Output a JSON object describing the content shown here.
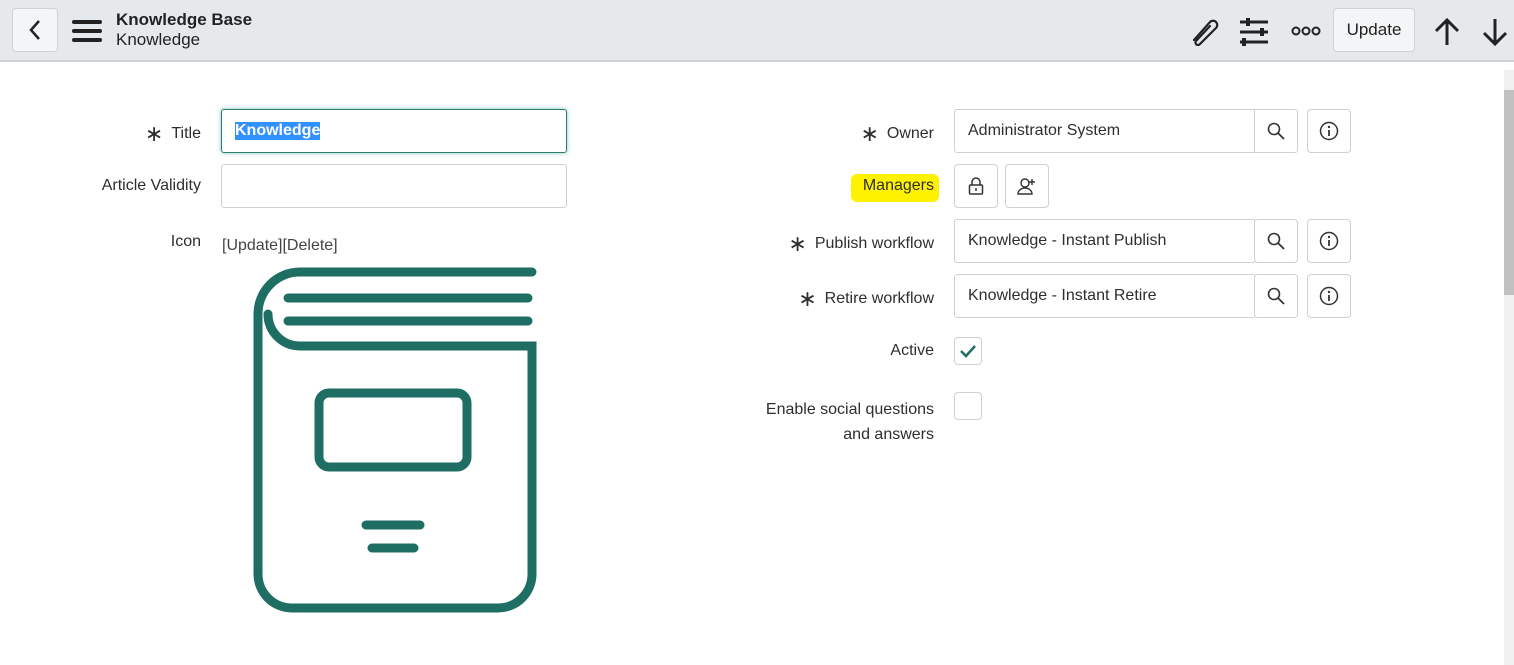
{
  "header": {
    "title": "Knowledge Base",
    "subtitle": "Knowledge",
    "update_label": "Update"
  },
  "form": {
    "title": {
      "label": "Title",
      "value": "Knowledge"
    },
    "article_validity": {
      "label": "Article Validity",
      "value": ""
    },
    "icon": {
      "label": "Icon",
      "update_link": "[Update]",
      "delete_link": "[Delete]"
    },
    "owner": {
      "label": "Owner",
      "value": "Administrator System"
    },
    "managers": {
      "label": "Managers"
    },
    "publish_workflow": {
      "label": "Publish workflow",
      "value": "Knowledge - Instant Publish"
    },
    "retire_workflow": {
      "label": "Retire workflow",
      "value": "Knowledge - Instant Retire"
    },
    "active": {
      "label": "Active",
      "checked": true
    },
    "social_qa": {
      "label_line1": "Enable social questions",
      "label_line2": "and answers",
      "checked": false
    }
  },
  "colors": {
    "accent": "#1f6e63",
    "highlight": "#fff200"
  }
}
